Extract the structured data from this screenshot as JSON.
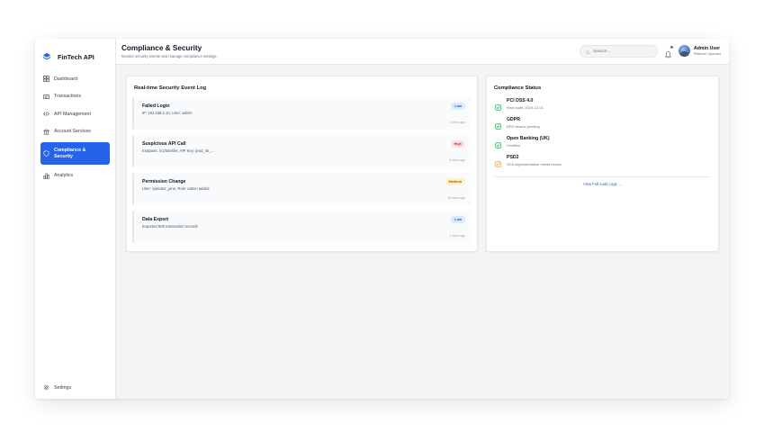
{
  "brand": {
    "name": "FinTech API"
  },
  "sidebar": {
    "items": [
      {
        "label": "Dashboard",
        "icon": "grid-icon"
      },
      {
        "label": "Transactions",
        "icon": "receipt-icon"
      },
      {
        "label": "API Management",
        "icon": "code-icon"
      },
      {
        "label": "Account Services",
        "icon": "bank-icon"
      },
      {
        "label": "Compliance & Security",
        "icon": "shield-icon",
        "active": true
      },
      {
        "label": "Analytics",
        "icon": "bar-chart-icon"
      }
    ],
    "settings_label": "Settings"
  },
  "header": {
    "title": "Compliance & Security",
    "subtitle": "Monitor security events and manage compliance settings.",
    "search_placeholder": "Search...",
    "user_name": "Admin User",
    "user_role": "Platform Operator"
  },
  "event_log": {
    "title": "Real-time Security Event Log",
    "events": [
      {
        "title": "Failed Login",
        "detail": "IP: 192.168.1.10, User: admin",
        "severity": "Low",
        "time": "2 mins ago"
      },
      {
        "title": "Suspicious API Call",
        "detail": "Endpoint: /v1/transfer, API Key: prod_sk_...",
        "severity": "High",
        "time": "5 mins ago"
      },
      {
        "title": "Permission Change",
        "detail": "User: operator_jane, Role: admin added",
        "severity": "Medium",
        "time": "15 mins ago"
      },
      {
        "title": "Data Export",
        "detail": "Exported 500 transaction records",
        "severity": "Low",
        "time": "1 hour ago"
      }
    ]
  },
  "compliance": {
    "title": "Compliance Status",
    "items": [
      {
        "name": "PCI DSS 4.0",
        "status": "Next audit: 2024-12-01",
        "state": "ok"
      },
      {
        "name": "GDPR",
        "status": "DPO review pending",
        "state": "ok"
      },
      {
        "name": "Open Banking (UK)",
        "status": "Certified",
        "state": "ok"
      },
      {
        "name": "PSD2",
        "status": "SCA implementation needs review",
        "state": "warning"
      }
    ],
    "link_label": "View Full Audit Logs →"
  },
  "colors": {
    "accent": "#2563eb",
    "ok": "#16a34a",
    "warning": "#f59e0b",
    "high": "#dc2626",
    "medium": "#b45309",
    "low": "#1d4ed8"
  }
}
